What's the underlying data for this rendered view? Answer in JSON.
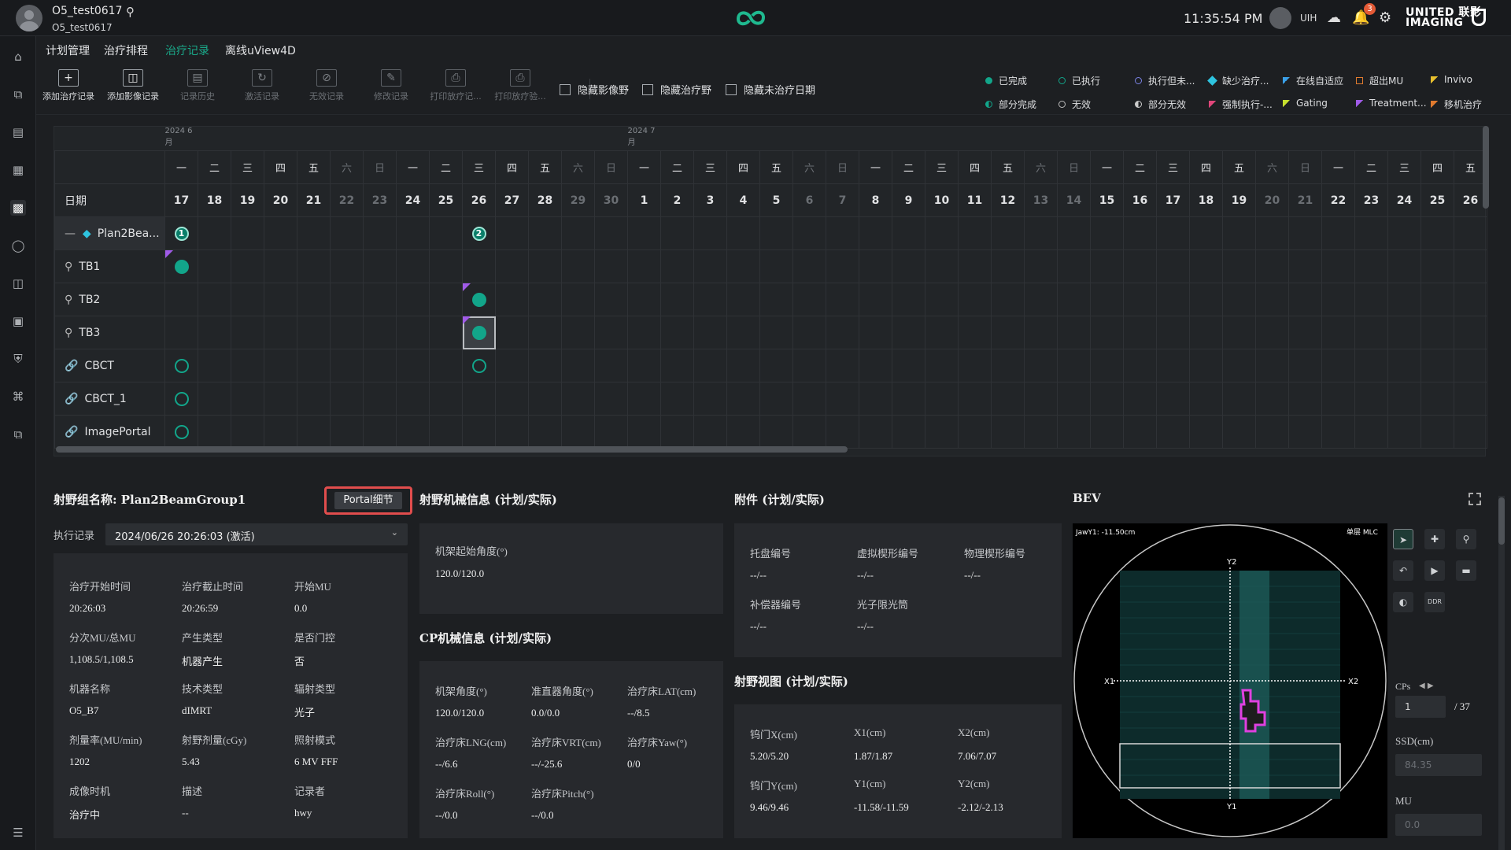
{
  "topbar": {
    "user_name": "O5_test0617",
    "user_sub": "O5_test0617",
    "clock": "11:35:54 PM",
    "user": "UIH",
    "notif_count": "3",
    "brand_l1": "UNITED 联影",
    "brand_l2": "IMAGING"
  },
  "menu": [
    "计划管理",
    "治疗排程",
    "治疗记录",
    "离线uView4D"
  ],
  "toolbar": {
    "buttons": [
      "添加治疗记录",
      "添加影像记录",
      "记录历史",
      "激活记录",
      "无效记录",
      "修改记录",
      "打印放疗记...",
      "打印放疗验..."
    ],
    "checks": [
      "隐藏影像野",
      "隐藏治疗野",
      "隐藏未治疗日期"
    ]
  },
  "legend": [
    {
      "label": "已完成",
      "color": "#12a58a"
    },
    {
      "label": "已执行",
      "color": "#12a58a"
    },
    {
      "label": "执行但未...",
      "color": "#7b83e6"
    },
    {
      "label": "缺少治疗...",
      "color": "#2ec4e0"
    },
    {
      "label": "在线自适应",
      "color": "#3aa0e8"
    },
    {
      "label": "超出MU",
      "color": "#e07a2e"
    },
    {
      "label": "Invivo",
      "color": "#e8c02e"
    },
    {
      "label": "部分完成",
      "color": "#12a58a"
    },
    {
      "label": "无效",
      "color": "#bbbbbb"
    },
    {
      "label": "部分无效",
      "color": "#cccccc"
    },
    {
      "label": "强制执行-...",
      "color": "#e0467a"
    },
    {
      "label": "Gating",
      "color": "#c6e02e"
    },
    {
      "label": "Treatment...",
      "color": "#a05be8"
    },
    {
      "label": "移机治疗",
      "color": "#e07a2e"
    }
  ],
  "calendar": {
    "month1": "2024 6月",
    "month2": "2024 7月",
    "date_label": "日期",
    "weekdays": [
      "一",
      "二",
      "三",
      "四",
      "五",
      "六",
      "日",
      "一",
      "二",
      "三",
      "四",
      "五",
      "六",
      "日",
      "一",
      "二",
      "三",
      "四",
      "五",
      "六",
      "日",
      "一",
      "二",
      "三",
      "四",
      "五",
      "六",
      "日",
      "一",
      "二",
      "三",
      "四",
      "五",
      "六",
      "日",
      "一",
      "二",
      "三",
      "四",
      "五"
    ],
    "days": [
      "17",
      "18",
      "19",
      "20",
      "21",
      "22",
      "23",
      "24",
      "25",
      "26",
      "27",
      "28",
      "29",
      "30",
      "1",
      "2",
      "3",
      "4",
      "5",
      "6",
      "7",
      "8",
      "9",
      "10",
      "11",
      "12",
      "13",
      "14",
      "15",
      "16",
      "17",
      "18",
      "19",
      "20",
      "21",
      "22",
      "23",
      "24",
      "25",
      "26"
    ],
    "rows": [
      "Plan2Bea...",
      "TB1",
      "TB2",
      "TB3",
      "CBCT",
      "CBCT_1",
      "ImagePortal"
    ]
  },
  "group": {
    "title": "射野组名称: Plan2BeamGroup1",
    "portal_btn": "Portal细节",
    "exec_label": "执行记录",
    "exec_value": "2024/06/26 20:26:03 (激活)",
    "fields": [
      {
        "l": "治疗开始时间",
        "v": "20:26:03"
      },
      {
        "l": "治疗截止时间",
        "v": "20:26:59"
      },
      {
        "l": "开始MU",
        "v": "0.0"
      },
      {
        "l": "分次MU/总MU",
        "v": "1,108.5/1,108.5"
      },
      {
        "l": "产生类型",
        "v": "机器产生"
      },
      {
        "l": "是否门控",
        "v": "否"
      },
      {
        "l": "机器名称",
        "v": "O5_B7"
      },
      {
        "l": "技术类型",
        "v": "dIMRT"
      },
      {
        "l": "辐射类型",
        "v": "光子"
      },
      {
        "l": "剂量率(MU/min)",
        "v": "1202"
      },
      {
        "l": "射野剂量(cGy)",
        "v": "5.43"
      },
      {
        "l": "照射模式",
        "v": "6 MV FFF"
      },
      {
        "l": "成像时机",
        "v": "治疗中"
      },
      {
        "l": "描述",
        "v": "--"
      },
      {
        "l": "记录者",
        "v": "hwy"
      }
    ]
  },
  "mech": {
    "title": "射野机械信息 (计划/实际)",
    "label": "机架起始角度(°)",
    "value": "120.0/120.0"
  },
  "cp": {
    "title": "CP机械信息 (计划/实际)",
    "fields": [
      {
        "l": "机架角度(°)",
        "v": "120.0/120.0"
      },
      {
        "l": "准直器角度(°)",
        "v": "0.0/0.0"
      },
      {
        "l": "治疗床LAT(cm)",
        "v": "--/8.5"
      },
      {
        "l": "治疗床LNG(cm)",
        "v": "--/6.6"
      },
      {
        "l": "治疗床VRT(cm)",
        "v": "--/-25.6"
      },
      {
        "l": "治疗床Yaw(°)",
        "v": "0/0"
      },
      {
        "l": "治疗床Roll(°)",
        "v": "--/0.0"
      },
      {
        "l": "治疗床Pitch(°)",
        "v": "--/0.0"
      }
    ]
  },
  "acc": {
    "title": "附件 (计划/实际)",
    "fields": [
      {
        "l": "托盘编号",
        "v": "--/--"
      },
      {
        "l": "虚拟楔形编号",
        "v": "--/--"
      },
      {
        "l": "物理楔形编号",
        "v": "--/--"
      },
      {
        "l": "补偿器编号",
        "v": "--/--"
      },
      {
        "l": "光子限光筒",
        "v": "--/--"
      }
    ]
  },
  "fieldview": {
    "title": "射野视图 (计划/实际)",
    "fields": [
      {
        "l": "钨门X(cm)",
        "v": "5.20/5.20"
      },
      {
        "l": "X1(cm)",
        "v": "1.87/1.87"
      },
      {
        "l": "X2(cm)",
        "v": "7.06/7.07"
      },
      {
        "l": "钨门Y(cm)",
        "v": "9.46/9.46"
      },
      {
        "l": "Y1(cm)",
        "v": "-11.58/-11.59"
      },
      {
        "l": "Y2(cm)",
        "v": "-2.12/-2.13"
      }
    ]
  },
  "bev": {
    "title": "BEV",
    "jaw": "JawY1: -11.50cm",
    "mlc": "单层 MLC",
    "y2": "Y2",
    "y1": "Y1",
    "x1": "X1",
    "x2": "X2",
    "cps_label": "CPs",
    "cp_value": "1",
    "cp_total": "/ 37",
    "ssd_label": "SSD(cm)",
    "ssd_value": "84.35",
    "mu_label": "MU",
    "mu_value": "0.0",
    "ddr": "DDR"
  }
}
